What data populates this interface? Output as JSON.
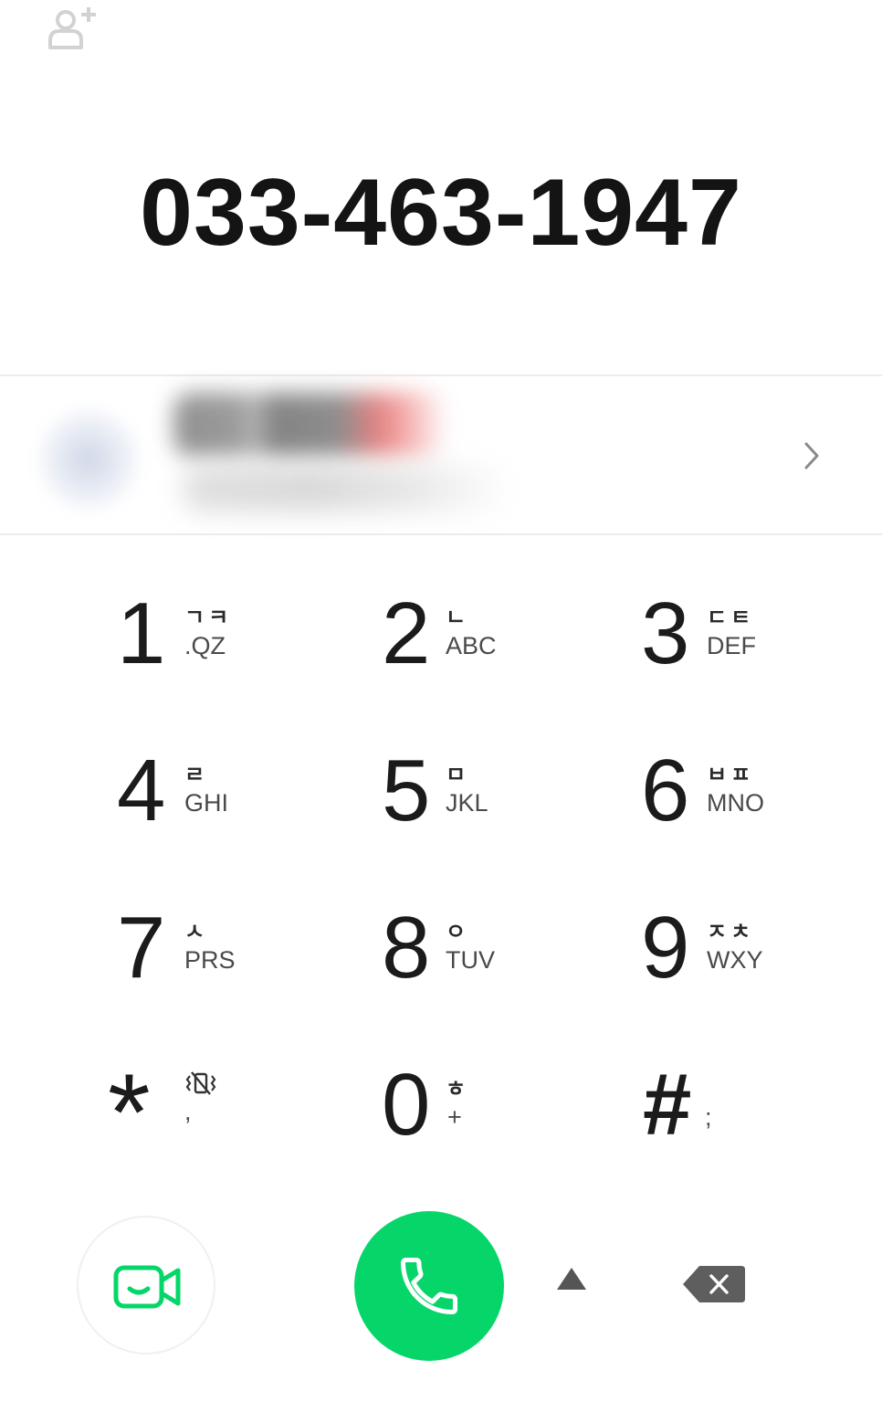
{
  "dialer": {
    "number": "033-463-1947"
  },
  "keypad": [
    {
      "digit": "1",
      "ko": "ㄱㅋ",
      "en": ".QZ"
    },
    {
      "digit": "2",
      "ko": "ㄴ",
      "en": "ABC"
    },
    {
      "digit": "3",
      "ko": "ㄷㅌ",
      "en": "DEF"
    },
    {
      "digit": "4",
      "ko": "ㄹ",
      "en": "GHI"
    },
    {
      "digit": "5",
      "ko": "ㅁ",
      "en": "JKL"
    },
    {
      "digit": "6",
      "ko": "ㅂㅍ",
      "en": "MNO"
    },
    {
      "digit": "7",
      "ko": "ㅅ",
      "en": "PRS"
    },
    {
      "digit": "8",
      "ko": "ㅇ",
      "en": "TUV"
    },
    {
      "digit": "9",
      "ko": "ㅈㅊ",
      "en": "WXY"
    },
    {
      "digit": "*",
      "ko": "",
      "en": ","
    },
    {
      "digit": "0",
      "ko": "ㅎ",
      "en": "+"
    },
    {
      "digit": "#",
      "ko": "",
      "en": ";"
    }
  ],
  "icons": {
    "add_contact": "add-contact-icon",
    "suggestion_chevron": "chevron-right-icon",
    "mute_vibrate": "vibrate-off-icon",
    "video_call": "video-call-icon",
    "call": "phone-icon",
    "expand": "triangle-up-icon",
    "backspace": "backspace-icon"
  },
  "colors": {
    "call_green": "#06d66a",
    "text_dark": "#141414",
    "icon_gray": "#5a5a5a",
    "divider": "#ececec"
  }
}
